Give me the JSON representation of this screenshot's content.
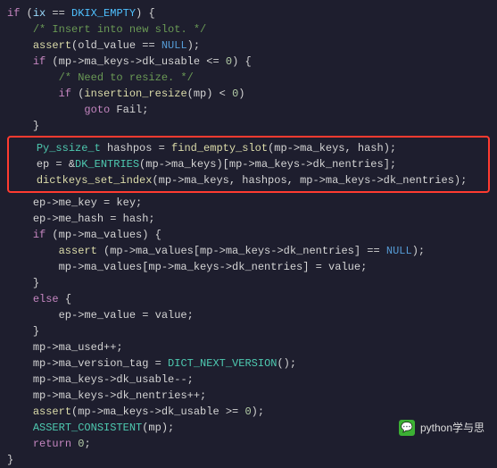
{
  "code": {
    "l1_if": "if",
    "l1_var": "ix",
    "l1_eq": " == ",
    "l1_const": "DKIX_EMPTY",
    "l1_end": ") {",
    "l2": "/* Insert into new slot. */",
    "l3_fn": "assert",
    "l3_arg": "(old_value == ",
    "l3_null": "NULL",
    "l3_end": ");",
    "l4_if": "if",
    "l4_body": " (mp->ma_keys->dk_usable <= ",
    "l4_zero": "0",
    "l4_end": ") {",
    "l5": "/* Need to resize. */",
    "l6_if": "if",
    "l6_open": " (",
    "l6_fn": "insertion_resize",
    "l6_arg": "(mp) < ",
    "l6_zero": "0",
    "l6_end": ")",
    "l7_goto": "goto",
    "l7_label": " Fail;",
    "l8": "}",
    "h1_type": "Py_ssize_t",
    "h1_var": " hashpos = ",
    "h1_fn": "find_empty_slot",
    "h1_args": "(mp->ma_keys, hash);",
    "h2_a": "ep = &",
    "h2_mac": "DK_ENTRIES",
    "h2_b": "(mp->ma_keys)[mp->ma_keys->dk_nentries];",
    "h3_fn": "dictkeys_set_index",
    "h3_args": "(mp->ma_keys, hashpos, mp->ma_keys->dk_nentries);",
    "l9": "ep->me_key = key;",
    "l10": "ep->me_hash = hash;",
    "l11_if": "if",
    "l11_body": " (mp->ma_values) {",
    "l12_fn": "assert",
    "l12_body": " (mp->ma_values[mp->ma_keys->dk_nentries] == ",
    "l12_null": "NULL",
    "l12_end": ");",
    "l13": "mp->ma_values[mp->ma_keys->dk_nentries] = value;",
    "l14": "}",
    "l15_else": "else",
    "l15_end": " {",
    "l16": "ep->me_value = value;",
    "l17": "}",
    "l18": "mp->ma_used++;",
    "l19a": "mp->ma_version_tag = ",
    "l19_mac": "DICT_NEXT_VERSION",
    "l19b": "();",
    "l20": "mp->ma_keys->dk_usable--;",
    "l21": "mp->ma_keys->dk_nentries++;",
    "l22_fn": "assert",
    "l22_body": "(mp->ma_keys->dk_usable >= ",
    "l22_zero": "0",
    "l22_end": ");",
    "l23_mac": "ASSERT_CONSISTENT",
    "l23_end": "(mp);",
    "l24_ret": "return",
    "l24_zero": " 0",
    "l24_end": ";",
    "l25": "}"
  },
  "watermark": {
    "icon": "💬",
    "text": "python学与思"
  }
}
